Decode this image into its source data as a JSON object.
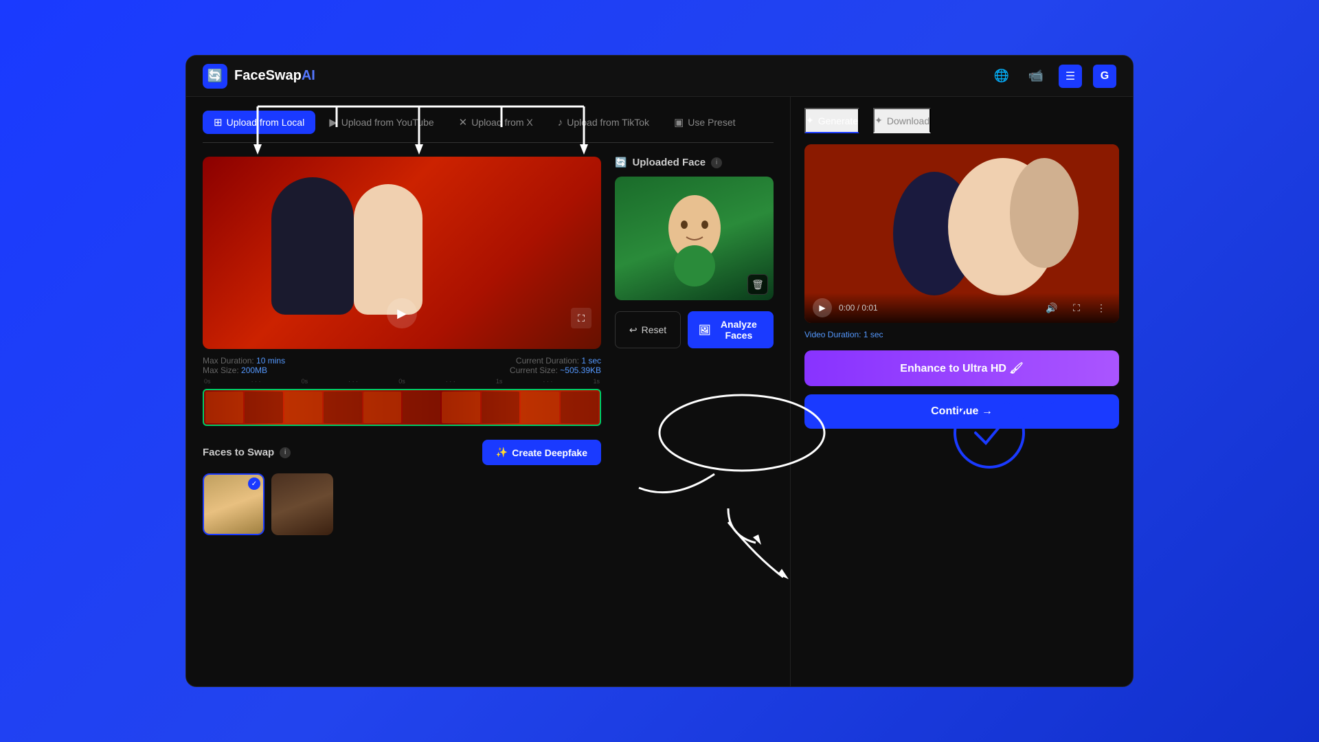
{
  "app": {
    "name": "FaceSwap",
    "name_accent": "AI",
    "logo_char": "🔄"
  },
  "header": {
    "globe_icon": "🌐",
    "video_icon": "📹",
    "menu_icon": "☰",
    "user_initial": "G"
  },
  "upload_tabs": [
    {
      "id": "local",
      "label": "Upload from Local",
      "icon": "⊞",
      "active": true
    },
    {
      "id": "youtube",
      "label": "Upload from YouTube",
      "icon": "▶",
      "active": false
    },
    {
      "id": "x",
      "label": "Upload from X",
      "icon": "✕",
      "active": false
    },
    {
      "id": "tiktok",
      "label": "Upload from TikTok",
      "icon": "♪",
      "active": false
    },
    {
      "id": "preset",
      "label": "Use Preset",
      "icon": "▣",
      "active": false
    }
  ],
  "video_section": {
    "max_duration_label": "Max Duration:",
    "max_duration_value": "10 mins",
    "max_size_label": "Max Size:",
    "max_size_value": "200MB",
    "current_duration_label": "Current Duration:",
    "current_duration_value": "1 sec",
    "current_size_label": "Current Size:",
    "current_size_value": "~505.39KB",
    "timeline_ticks": [
      "0s",
      "0s",
      "0s",
      "1s",
      "1s"
    ]
  },
  "face_upload": {
    "title": "Uploaded Face",
    "info_label": "i",
    "sync_icon": "🔄",
    "delete_icon": "🗑"
  },
  "face_actions": {
    "reset_label": "Reset",
    "reset_icon": "↩",
    "analyze_label": "Analyze Faces",
    "analyze_icon": "🖼"
  },
  "faces_to_swap": {
    "title": "Faces to Swap",
    "info_label": "i",
    "create_deepfake_label": "Create Deepfake",
    "create_deepfake_icon": "✨",
    "faces": [
      {
        "id": 1,
        "type": "blonde",
        "selected": true
      },
      {
        "id": 2,
        "type": "dark",
        "selected": false
      }
    ]
  },
  "right_panel": {
    "tabs": [
      {
        "label": "Generate",
        "icon": "✦",
        "active": true
      },
      {
        "label": "Download",
        "icon": "✦",
        "active": false
      }
    ],
    "video_duration_label": "Video Duration:",
    "video_duration_value": "1 sec",
    "time_display": "0:00 / 0:01",
    "enhance_label": "Enhance to Ultra HD 🖌",
    "continue_label": "Continue →"
  }
}
